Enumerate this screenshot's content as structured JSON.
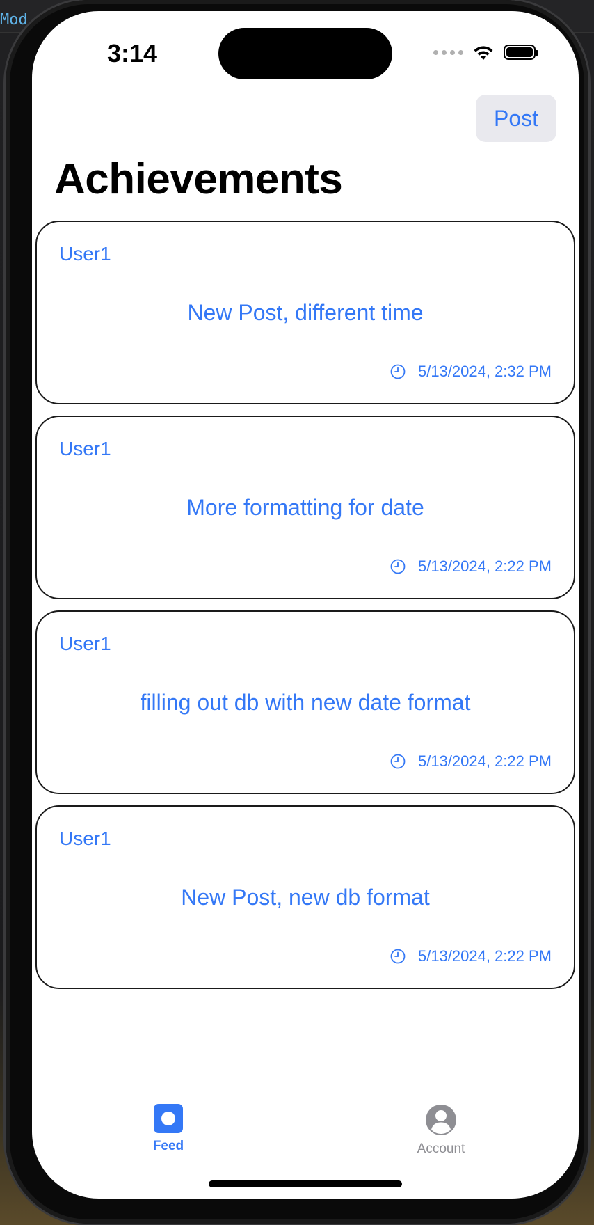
{
  "editor": {
    "tab_label": "Mod"
  },
  "status_bar": {
    "time": "3:14"
  },
  "nav": {
    "post_button_label": "Post"
  },
  "page": {
    "title": "Achievements"
  },
  "posts": [
    {
      "user": "User1",
      "text": "New Post, different time",
      "timestamp": "5/13/2024, 2:32 PM"
    },
    {
      "user": "User1",
      "text": "More formatting for date",
      "timestamp": "5/13/2024, 2:22 PM"
    },
    {
      "user": "User1",
      "text": "filling out db with new date format",
      "timestamp": "5/13/2024, 2:22 PM"
    },
    {
      "user": "User1",
      "text": "New Post, new db format",
      "timestamp": "5/13/2024, 2:22 PM"
    }
  ],
  "tabbar": {
    "feed_label": "Feed",
    "account_label": "Account",
    "selected": "Feed"
  },
  "icons": {
    "feed": "feed-icon",
    "account": "person-circle-icon",
    "timestamp": "clock-icon",
    "wifi": "wifi-icon",
    "battery": "battery-icon"
  },
  "colors": {
    "accent": "#3478f6",
    "inactive": "#8e8e93",
    "button_bg": "#e9e9ee"
  }
}
